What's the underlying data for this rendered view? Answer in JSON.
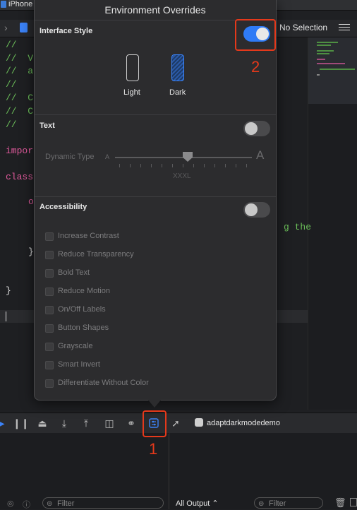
{
  "window": {
    "title_fragment": "iPhone"
  },
  "jumpbar": {
    "selection_label": "No Selection"
  },
  "code": {
    "lines": [
      {
        "text": "//",
        "color": "#6bbf59"
      },
      {
        "text": "//  V",
        "color": "#6bbf59"
      },
      {
        "text": "//  a",
        "color": "#6bbf59"
      },
      {
        "text": "//",
        "color": "#6bbf59"
      },
      {
        "text": "//  C",
        "color": "#6bbf59"
      },
      {
        "text": "//  C",
        "color": "#6bbf59"
      },
      {
        "text": "//",
        "color": "#6bbf59"
      },
      {
        "text": "impor",
        "color": "#e05a9c"
      },
      {
        "text": "class",
        "color": "#e05a9c"
      },
      {
        "text": "o",
        "color": "#e05a9c"
      },
      {
        "text": "}",
        "color": "#e0e0e0"
      },
      {
        "text": "}",
        "color": "#e0e0e0"
      }
    ],
    "right_fragment": "g the"
  },
  "popover": {
    "title": "Environment Overrides",
    "interface_style": {
      "label": "Interface Style",
      "enabled": true,
      "options": [
        {
          "label": "Light",
          "selected": false
        },
        {
          "label": "Dark",
          "selected": true
        }
      ]
    },
    "text": {
      "label": "Text",
      "enabled": false,
      "dynamic_type_label": "Dynamic Type",
      "small_a": "A",
      "large_a": "A",
      "current_size": "XXXL"
    },
    "accessibility": {
      "label": "Accessibility",
      "enabled": false,
      "options": [
        {
          "label": "Increase Contrast",
          "checked": false
        },
        {
          "label": "Reduce Transparency",
          "checked": false
        },
        {
          "label": "Bold Text",
          "checked": false
        },
        {
          "label": "Reduce Motion",
          "checked": false
        },
        {
          "label": "On/Off Labels",
          "checked": false
        },
        {
          "label": "Button Shapes",
          "checked": false
        },
        {
          "label": "Grayscale",
          "checked": false
        },
        {
          "label": "Smart Invert",
          "checked": false
        },
        {
          "label": "Differentiate Without Color",
          "checked": false
        }
      ]
    }
  },
  "debugbar": {
    "app_name": "adaptdarkmodedemo"
  },
  "bottom": {
    "left_filter_placeholder": "Filter",
    "output_selector": "All Output",
    "right_filter_placeholder": "Filter"
  },
  "annotations": {
    "label_1": "1",
    "label_2": "2",
    "color": "#e5391b"
  },
  "colors": {
    "accent": "#2f7bf6",
    "comment": "#6bbf59",
    "keyword": "#e05a9c"
  }
}
